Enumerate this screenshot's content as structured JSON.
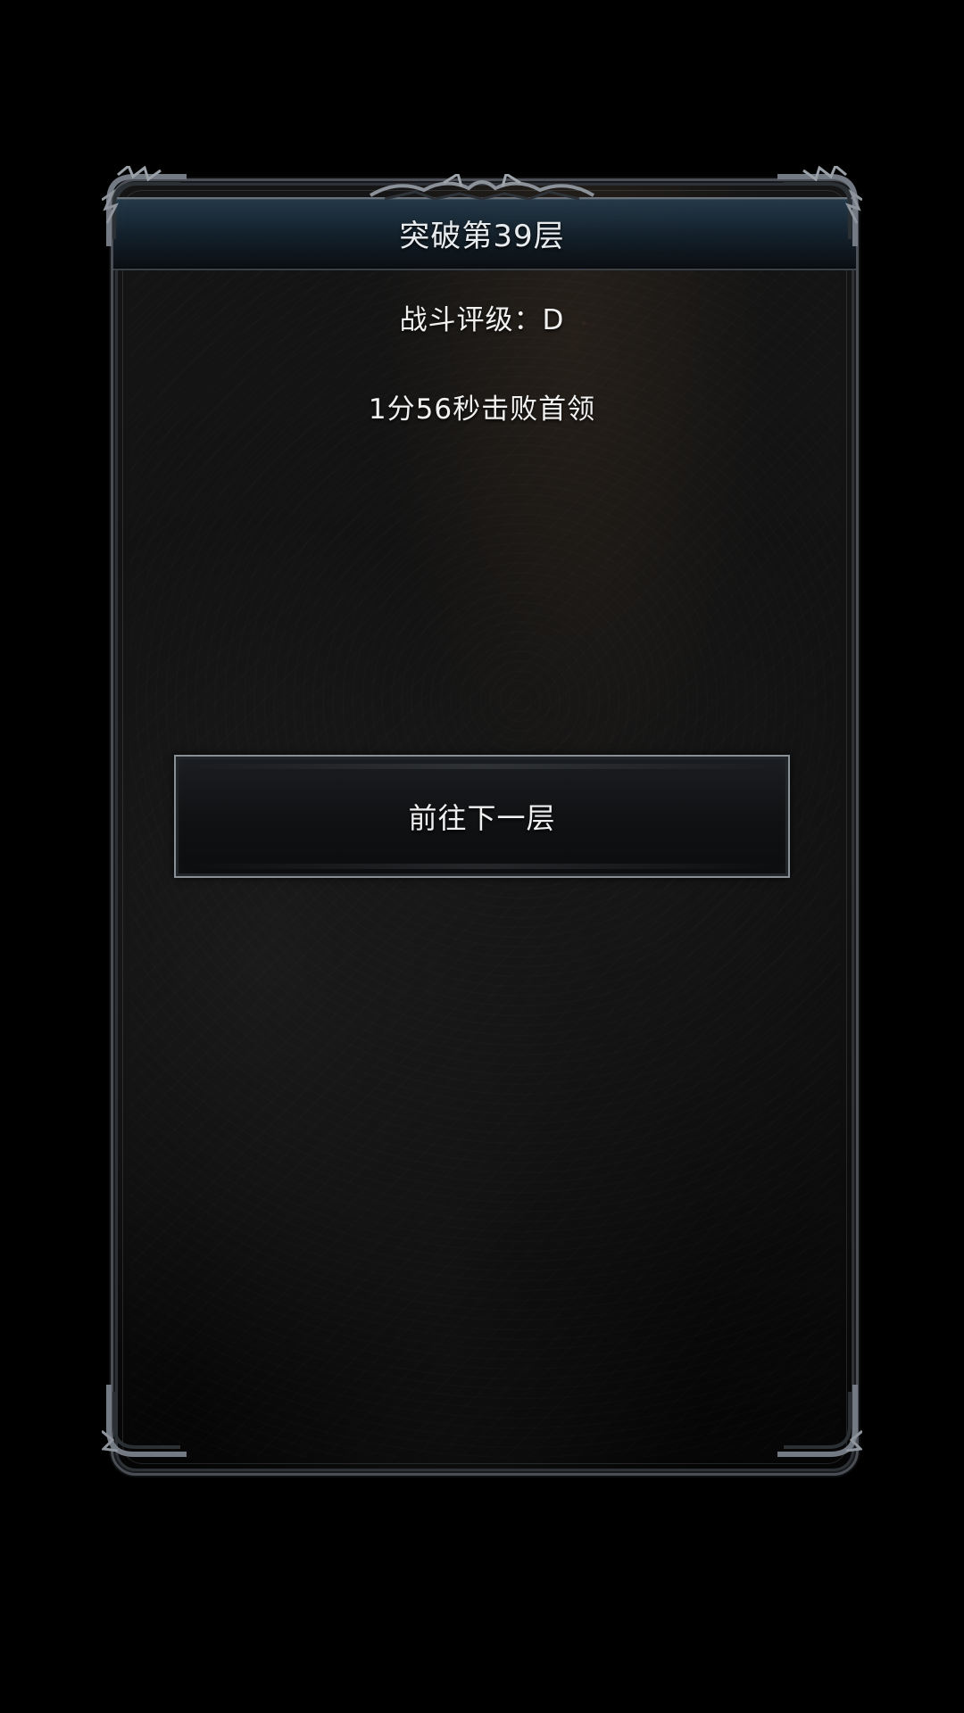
{
  "dialog": {
    "title": "突破第39层",
    "rating": "战斗评级：D",
    "boss_time": "1分56秒击败首领",
    "next_button": "前往下一层"
  },
  "theme": {
    "frame_color": "#4b4f55",
    "accent_blue": "#263f52",
    "text_color": "#f1f1f1"
  }
}
